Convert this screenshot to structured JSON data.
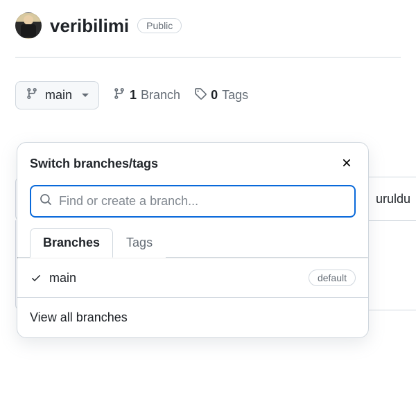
{
  "repo": {
    "name": "veribilimi",
    "visibility": "Public"
  },
  "branch_button": {
    "label": "main"
  },
  "stats": {
    "branch_count": "1",
    "branch_label": "Branch",
    "tag_count": "0",
    "tag_label": "Tags"
  },
  "bg": {
    "partial_text": "uruldu"
  },
  "popover": {
    "title": "Switch branches/tags",
    "search_placeholder": "Find or create a branch...",
    "tabs": {
      "branches": "Branches",
      "tags": "Tags"
    },
    "branch_item": {
      "name": "main",
      "badge": "default"
    },
    "view_all": "View all branches"
  }
}
